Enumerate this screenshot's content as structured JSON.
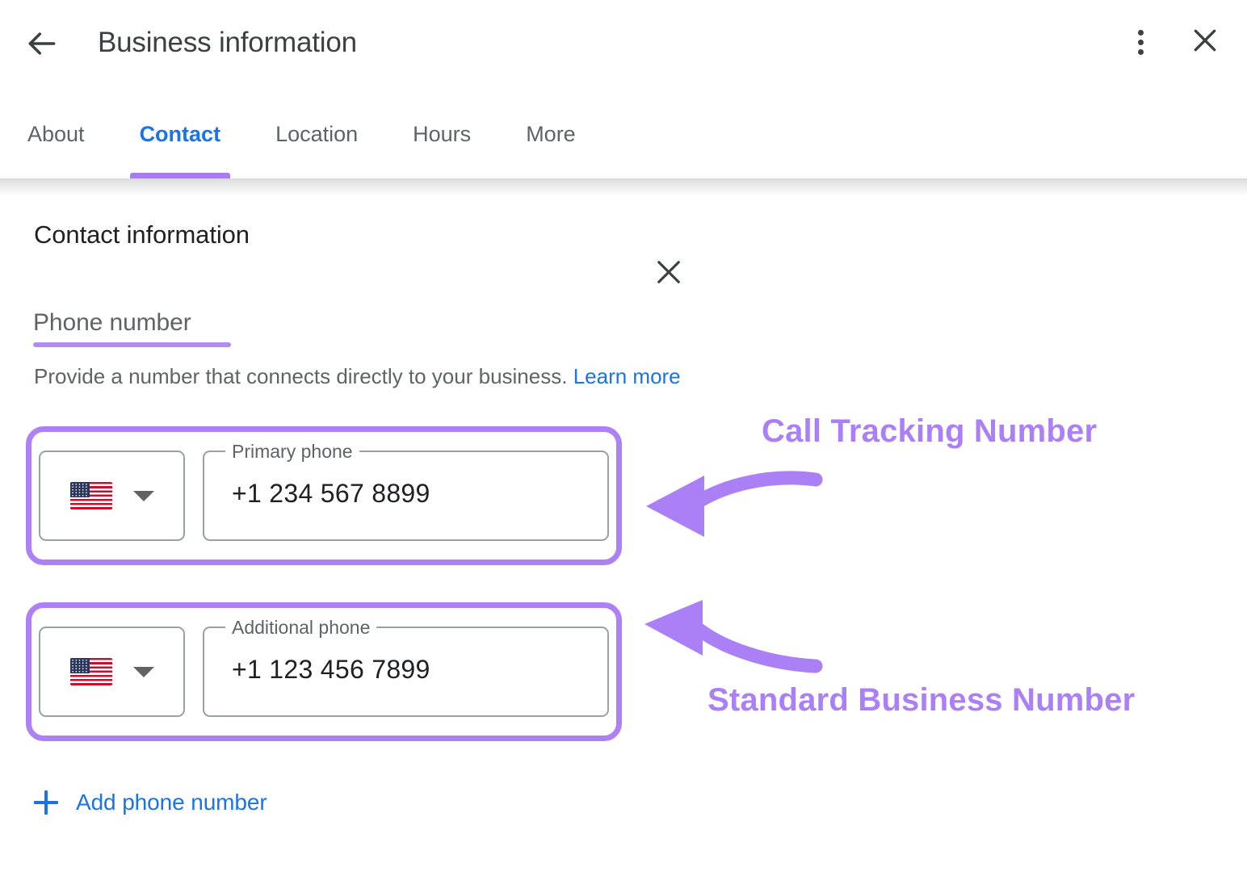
{
  "header": {
    "title": "Business information",
    "back_icon": "arrow-left-icon",
    "overflow_icon": "more-vertical-icon",
    "close_icon": "close-icon"
  },
  "tabs": [
    {
      "label": "About",
      "active": false
    },
    {
      "label": "Contact",
      "active": true
    },
    {
      "label": "Location",
      "active": false
    },
    {
      "label": "Hours",
      "active": false
    },
    {
      "label": "More",
      "active": false
    }
  ],
  "main": {
    "section_title": "Contact information",
    "field_label": "Phone number",
    "help_text": "Provide a number that connects directly to your business.",
    "learn_more": "Learn more",
    "add_phone_label": "Add phone number",
    "add_icon": "plus-icon",
    "remove_icon": "close-icon"
  },
  "phones": [
    {
      "label": "Primary phone",
      "value": "+1 234 567 8899",
      "country_flag": "us-flag-icon",
      "country_caret": "chevron-down-icon",
      "removable": false
    },
    {
      "label": "Additional phone",
      "value": "+1 123 456 7899",
      "country_flag": "us-flag-icon",
      "country_caret": "chevron-down-icon",
      "removable": true
    }
  ],
  "annotations": [
    {
      "text": "Call Tracking Number",
      "target": "primary-phone-field"
    },
    {
      "text": "Standard Business Number",
      "target": "additional-phone-field"
    }
  ],
  "colors": {
    "annotation_purple": "#ab7ff5",
    "link_blue": "#1a73e8",
    "text_primary": "#202124",
    "text_secondary": "#5f6368",
    "border_gray": "#9aa0a6"
  }
}
